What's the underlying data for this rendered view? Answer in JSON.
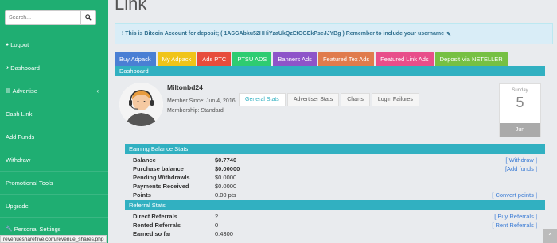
{
  "sidebar": {
    "search_placeholder": "Search...",
    "items": [
      {
        "label": "Logout",
        "icon": "dashboard-icon"
      },
      {
        "label": "Dashboard",
        "icon": "dashboard-icon"
      },
      {
        "label": "Advertise",
        "icon": "chart-icon"
      },
      {
        "label": "Cash Link"
      },
      {
        "label": "Add Funds"
      },
      {
        "label": "Withdraw"
      },
      {
        "label": "Promotional Tools"
      },
      {
        "label": "Upgrade"
      },
      {
        "label": "Personal Settings",
        "icon": "wrench-icon"
      }
    ]
  },
  "main": {
    "title": "Link",
    "alert": "! This is Bitcoin Account for deposit; ( 1ASGAbku52HHiYzaUkQzEtGGEkPseJJYBg ) Remember to include your username",
    "tabs": [
      {
        "label": "Buy Adpack",
        "color": "#4a7fd4"
      },
      {
        "label": "My Adpack",
        "color": "#f0c419"
      },
      {
        "label": "Ads PTC",
        "color": "#e74c3c"
      },
      {
        "label": "PTSU ADS",
        "color": "#2ecc71"
      },
      {
        "label": "Banners Ads",
        "color": "#8e54c9"
      },
      {
        "label": "Featured Tex Ads",
        "color": "#e07b4c"
      },
      {
        "label": "Featured Link Ads",
        "color": "#e84e8a"
      },
      {
        "label": "Deposit Via NETELLER",
        "color": "#76c043"
      }
    ],
    "dashboard_label": "Dashboard"
  },
  "profile": {
    "username": "Miltonbd24",
    "member_since": "Member Since: Jun 4, 2016",
    "membership": "Membership: Standard"
  },
  "stat_tabs": [
    "General Stats",
    "Advertiser Stats",
    "Charts",
    "Login Failures"
  ],
  "calendar": {
    "dayname": "Sunday",
    "day": "5",
    "month": "Jun"
  },
  "earning": {
    "header": "Earning Balance Stats",
    "rows": [
      {
        "label": "Balance",
        "value": "$0.7740",
        "link": "[ Withdraw ]"
      },
      {
        "label": "Purchase balance",
        "value": "$0.00000",
        "link": "[Add funds ]"
      },
      {
        "label": "Pending Withdrawls",
        "value": "$0.0000",
        "link": ""
      },
      {
        "label": "Payments Received",
        "value": "$0.0000",
        "link": ""
      },
      {
        "label": "Points",
        "value": "0.00 pts",
        "link": "[ Convert points ]"
      }
    ]
  },
  "referral": {
    "header": "Referral Stats",
    "rows": [
      {
        "label": "Direct Referrals",
        "value": "2",
        "link": "[ Buy Referrals ]"
      },
      {
        "label": "Rented Referrals",
        "value": "0",
        "link": "[ Rent Referrals ]"
      },
      {
        "label": "Earned so far",
        "value": "0.4300",
        "link": ""
      }
    ]
  },
  "status_url": "revenueshareflive.com/revenue_shares.php"
}
